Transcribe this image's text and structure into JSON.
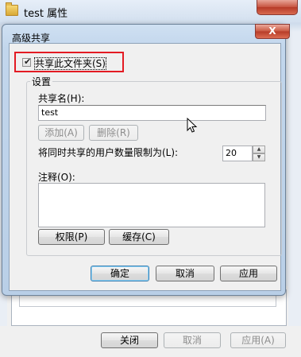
{
  "background_window": {
    "title": "test 属性",
    "buttons": {
      "close": "关闭",
      "cancel": "取消",
      "apply": "应用(A)"
    }
  },
  "dialog": {
    "title": "高级共享",
    "close_glyph": "X",
    "share_checkbox": {
      "label": "共享此文件夹(S)",
      "checked": true,
      "check_glyph": "✔"
    },
    "settings": {
      "group_title": "设置",
      "share_name_label": "共享名(H):",
      "share_name_value": "test",
      "add_button": "添加(A)",
      "remove_button": "删除(R)",
      "limit_label": "将同时共享的用户数量限制为(L):",
      "limit_value": "20",
      "comment_label": "注释(O):",
      "comment_value": "",
      "permissions_button": "权限(P)",
      "caching_button": "缓存(C)"
    },
    "footer": {
      "ok": "确定",
      "cancel": "取消",
      "apply": "应用"
    }
  },
  "icons": {
    "folder": "folder-icon",
    "spin_up": "spin-up-icon",
    "spin_down": "spin-down-icon",
    "cursor": "mouse-cursor-icon"
  },
  "colors": {
    "highlight_box": "#e31b23",
    "default_button_border": "#3c7fb1"
  }
}
